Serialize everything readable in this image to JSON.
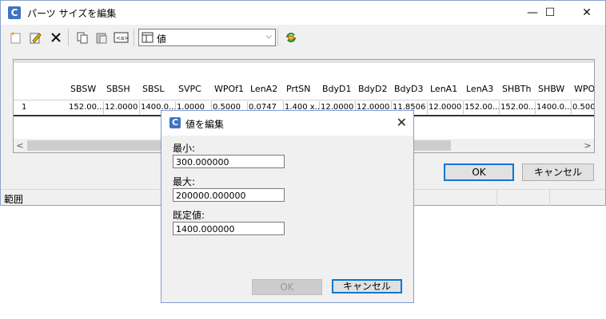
{
  "main_window": {
    "title": "パーツ サイズを編集",
    "controls": {
      "minimize": "—",
      "maximize": "☐",
      "close": "✕"
    },
    "toolbar": {
      "buttons": [
        "new-row-icon",
        "edit-icon",
        "delete-icon",
        "copy-icon",
        "paste-icon",
        "variable-icon"
      ],
      "view_combo_value": "値",
      "refresh_button": "refresh-icon"
    },
    "grid": {
      "row_header": "1",
      "columns": [
        "SBSW",
        "SBSH",
        "SBSL",
        "SVPC",
        "WPOf1",
        "LenA2",
        "PrtSN",
        "BdyD1",
        "BdyD2",
        "BdyD3",
        "LenA1",
        "LenA3",
        "SHBTh",
        "SHBW",
        "WPO"
      ],
      "rows": [
        [
          "152.00...",
          "12.0000",
          "1400.0...",
          "1.0000",
          "0.5000",
          "0.0747",
          "1.400 x...",
          "12.0000",
          "12.0000",
          "11.8506",
          "12.0000",
          "152.00...",
          "152.00...",
          "1400.0...",
          "0.500"
        ]
      ]
    },
    "ok_label": "OK",
    "cancel_label": "キャンセル",
    "status_text": "範囲"
  },
  "dialog": {
    "title": "値を編集",
    "min_label": "最小:",
    "min_value": "300.000000",
    "max_label": "最大:",
    "max_value": "200000.000000",
    "default_label": "既定値:",
    "default_value": "1400.000000",
    "ok_label": "OK",
    "cancel_label": "キャンセル"
  },
  "colors": {
    "accent": "#0078d7",
    "app_icon": "#3d74c4"
  }
}
